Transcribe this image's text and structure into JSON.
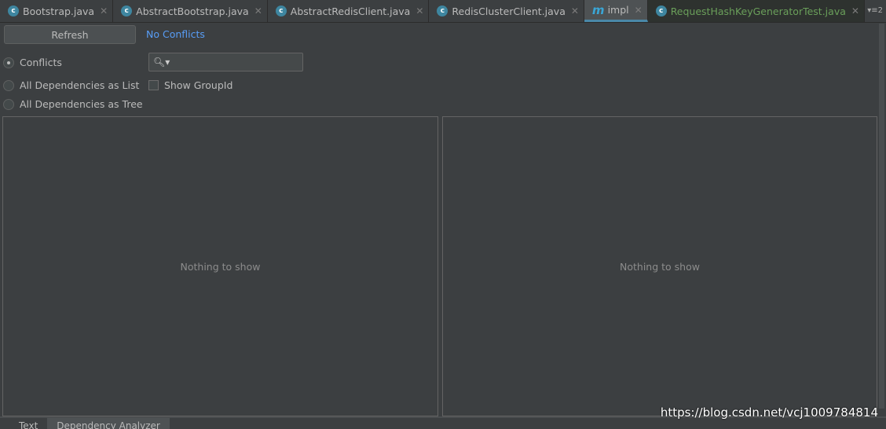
{
  "tabs": [
    {
      "label": "Bootstrap.java",
      "icon": "java-class-icon"
    },
    {
      "label": "AbstractBootstrap.java",
      "icon": "abstract-class-icon"
    },
    {
      "label": "AbstractRedisClient.java",
      "icon": "abstract-class-icon"
    },
    {
      "label": "RedisClusterClient.java",
      "icon": "java-class-icon"
    },
    {
      "label": "impl",
      "icon": "maven-icon",
      "active": true
    },
    {
      "label": "RequestHashKeyGeneratorTest.java",
      "icon": "test-class-icon"
    }
  ],
  "tab_overflow": "2",
  "toolbar": {
    "refresh": "Refresh",
    "status": "No Conflicts"
  },
  "view_modes": [
    {
      "label": "Conflicts",
      "selected": true
    },
    {
      "label": "All Dependencies as List",
      "selected": false
    },
    {
      "label": "All Dependencies as Tree",
      "selected": false
    }
  ],
  "search": {
    "value": "",
    "icon": "search-icon"
  },
  "show_group_id": {
    "label": "Show GroupId",
    "checked": false
  },
  "left_panel": {
    "empty": "Nothing to show"
  },
  "right_panel": {
    "empty": "Nothing to show"
  },
  "bottom_tabs": [
    {
      "label": "Text"
    },
    {
      "label": "Dependency Analyzer",
      "active": true
    }
  ],
  "watermark": "https://blog.csdn.net/vcj1009784814"
}
